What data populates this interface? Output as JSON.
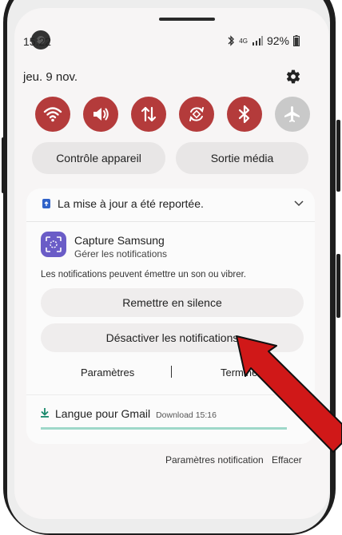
{
  "status_bar": {
    "time": "15:22",
    "battery": "92%",
    "network": "4G"
  },
  "date": "jeu. 9 nov.",
  "quick_settings": {
    "tiles": [
      {
        "name": "wifi",
        "icon": "wifi-icon",
        "active": true
      },
      {
        "name": "sound",
        "icon": "volume-icon",
        "active": true
      },
      {
        "name": "mobile-data",
        "icon": "data-transfer-icon",
        "active": true
      },
      {
        "name": "auto-rotate",
        "icon": "rotate-icon",
        "active": true
      },
      {
        "name": "bluetooth",
        "icon": "bluetooth-icon",
        "active": true
      },
      {
        "name": "airplane",
        "icon": "airplane-icon",
        "active": false
      }
    ],
    "device_control_label": "Contrôle appareil",
    "media_output_label": "Sortie média"
  },
  "notifications": {
    "update_text": "La mise à jour a été reportée.",
    "app_name": "Capture Samsung",
    "manage_label": "Gérer les notifications",
    "description": "Les notifications peuvent émettre un son ou vibrer.",
    "silence_label": "Remettre en silence",
    "disable_label": "Désactiver les notifications",
    "settings_label": "Paramètres",
    "done_label": "Terminé",
    "gmail_title": "Langue pour Gmail",
    "gmail_meta": "Download  15:16",
    "gmail_progress": 1.0
  },
  "footer": {
    "notification_settings_label": "Paramètres notification",
    "clear_label": "Effacer"
  },
  "colors": {
    "accent_red": "#b43b3b",
    "tile_off": "#c9c9c9",
    "arrow": "#d01818"
  }
}
